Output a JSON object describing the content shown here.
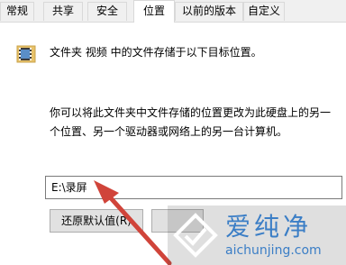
{
  "tabs": [
    {
      "label": "常规",
      "active": false
    },
    {
      "label": "共享",
      "active": false
    },
    {
      "label": "安全",
      "active": false
    },
    {
      "label": "位置",
      "active": true
    },
    {
      "label": "以前的版本",
      "active": false
    },
    {
      "label": "自定义",
      "active": false
    }
  ],
  "location": {
    "description": "文件夹 视频 中的文件存储于以下目标位置。",
    "explanation": "你可以将此文件夹中文件存储的位置更改为此硬盘上的另一个位置、另一个驱动器或网络上的另一台计算机。",
    "path_value": "E:\\录屏"
  },
  "buttons": {
    "restore_default": "还原默认值(R)"
  },
  "watermark": {
    "text": "爱纯净",
    "url": "aichunjing.com"
  },
  "colors": {
    "arrow": "#d0443a",
    "watermark_text": "#3b7ec6"
  }
}
